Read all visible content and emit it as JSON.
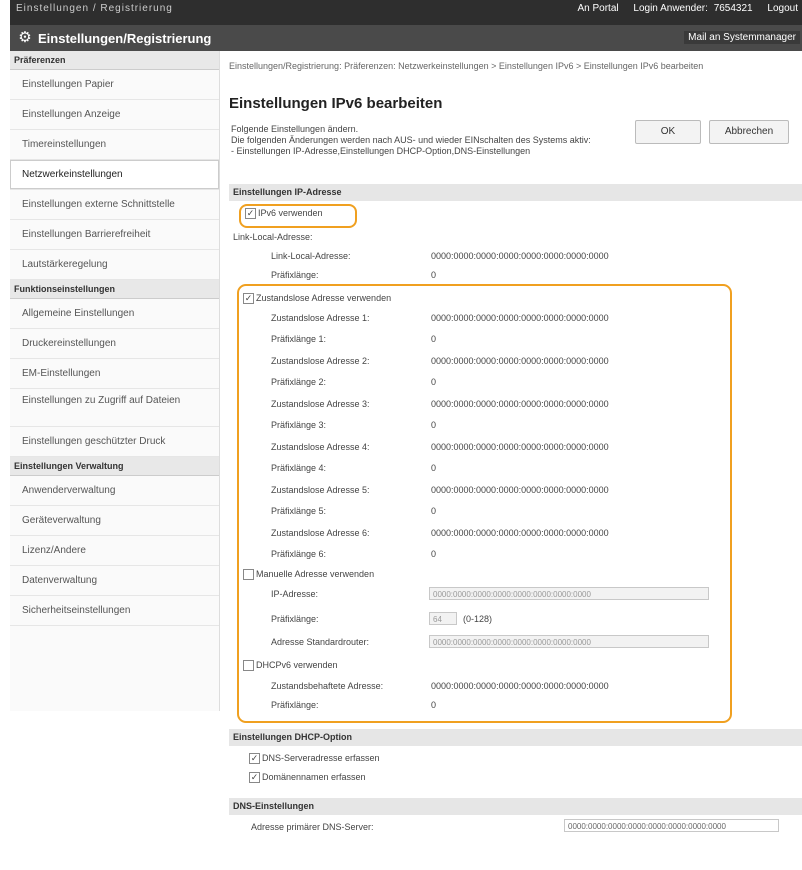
{
  "topbar": {
    "left_text": "Einstellungen / Registrierung",
    "portal": "An Portal",
    "login_user": "Login Anwender:",
    "user_id": "7654321",
    "logout": "Logout"
  },
  "header": {
    "title": "Einstellungen/Registrierung",
    "mail_admin": "Mail an Systemmanager"
  },
  "sidebar": {
    "sections": [
      {
        "title": "Präferenzen",
        "items": [
          "Einstellungen Papier",
          "Einstellungen Anzeige",
          "Timereinstellungen",
          "Netzwerkeinstellungen",
          "Einstellungen externe Schnittstelle",
          "Einstellungen Barrierefreiheit",
          "Lautstärkeregelung"
        ]
      },
      {
        "title": "Funktionseinstellungen",
        "items": [
          "Allgemeine Einstellungen",
          "Druckereinstellungen",
          "EM-Einstellungen",
          "Einstellungen zu Zugriff auf Dateien",
          "Einstellungen geschützter Druck"
        ]
      },
      {
        "title": "Einstellungen Verwaltung",
        "items": [
          "Anwenderverwaltung",
          "Geräteverwaltung",
          "Lizenz/Andere",
          "Datenverwaltung",
          "Sicherheitseinstellungen"
        ]
      }
    ]
  },
  "main": {
    "breadcrumb": "Einstellungen/Registrierung: Präferenzen: Netzwerkeinstellungen > Einstellungen IPv6 > Einstellungen IPv6 bearbeiten",
    "title": "Einstellungen IPv6 bearbeiten",
    "desc1": "Folgende Einstellungen ändern.",
    "desc2": "Die folgenden Änderungen werden nach AUS- und wieder EINschalten des Systems aktiv:",
    "desc3": "- Einstellungen IP-Adresse,Einstellungen DHCP-Option,DNS-Einstellungen",
    "ok": "OK",
    "cancel": "Abbrechen"
  },
  "ip": {
    "section": "Einstellungen IP-Adresse",
    "use_ipv6": "IPv6 verwenden",
    "link_local_title": "Link-Local-Adresse:",
    "link_local_label": "Link-Local-Adresse:",
    "link_local_value": "0000:0000:0000:0000:0000:0000:0000:0000",
    "prefix_label": "Präfixlänge:",
    "prefix_value": "0",
    "stateless_use": "Zustandslose Adresse verwenden",
    "stateless": [
      {
        "label": "Zustandslose Adresse 1:",
        "value": "0000:0000:0000:0000:0000:0000:0000:0000",
        "plabel": "Präfixlänge 1:",
        "pvalue": "0"
      },
      {
        "label": "Zustandslose Adresse 2:",
        "value": "0000:0000:0000:0000:0000:0000:0000:0000",
        "plabel": "Präfixlänge 2:",
        "pvalue": "0"
      },
      {
        "label": "Zustandslose Adresse 3:",
        "value": "0000:0000:0000:0000:0000:0000:0000:0000",
        "plabel": "Präfixlänge 3:",
        "pvalue": "0"
      },
      {
        "label": "Zustandslose Adresse 4:",
        "value": "0000:0000:0000:0000:0000:0000:0000:0000",
        "plabel": "Präfixlänge 4:",
        "pvalue": "0"
      },
      {
        "label": "Zustandslose Adresse 5:",
        "value": "0000:0000:0000:0000:0000:0000:0000:0000",
        "plabel": "Präfixlänge 5:",
        "pvalue": "0"
      },
      {
        "label": "Zustandslose Adresse 6:",
        "value": "0000:0000:0000:0000:0000:0000:0000:0000",
        "plabel": "Präfixlänge 6:",
        "pvalue": "0"
      }
    ],
    "manual_use": "Manuelle Adresse verwenden",
    "manual_ip_label": "IP-Adresse:",
    "manual_ip_value": "0000:0000:0000:0000:0000:0000:0000:0000",
    "manual_prefix_label": "Präfixlänge:",
    "manual_prefix_value": "64",
    "manual_prefix_range": "(0-128)",
    "router_label": "Adresse Standardrouter:",
    "router_value": "0000:0000:0000:0000:0000:0000:0000:0000",
    "dhcp_use": "DHCPv6 verwenden",
    "stateful_label": "Zustandsbehaftete Adresse:",
    "stateful_value": "0000:0000:0000:0000:0000:0000:0000:0000",
    "stateful_prefix_label": "Präfixlänge:",
    "stateful_prefix_value": "0"
  },
  "dhcp": {
    "section": "Einstellungen DHCP-Option",
    "dns_server": "DNS-Serveradresse erfassen",
    "domain_name": "Domänennamen erfassen"
  },
  "dns": {
    "section": "DNS-Einstellungen",
    "primary_label": "Adresse primärer DNS-Server:",
    "primary_value": "0000:0000:0000:0000:0000:0000:0000:0000"
  }
}
